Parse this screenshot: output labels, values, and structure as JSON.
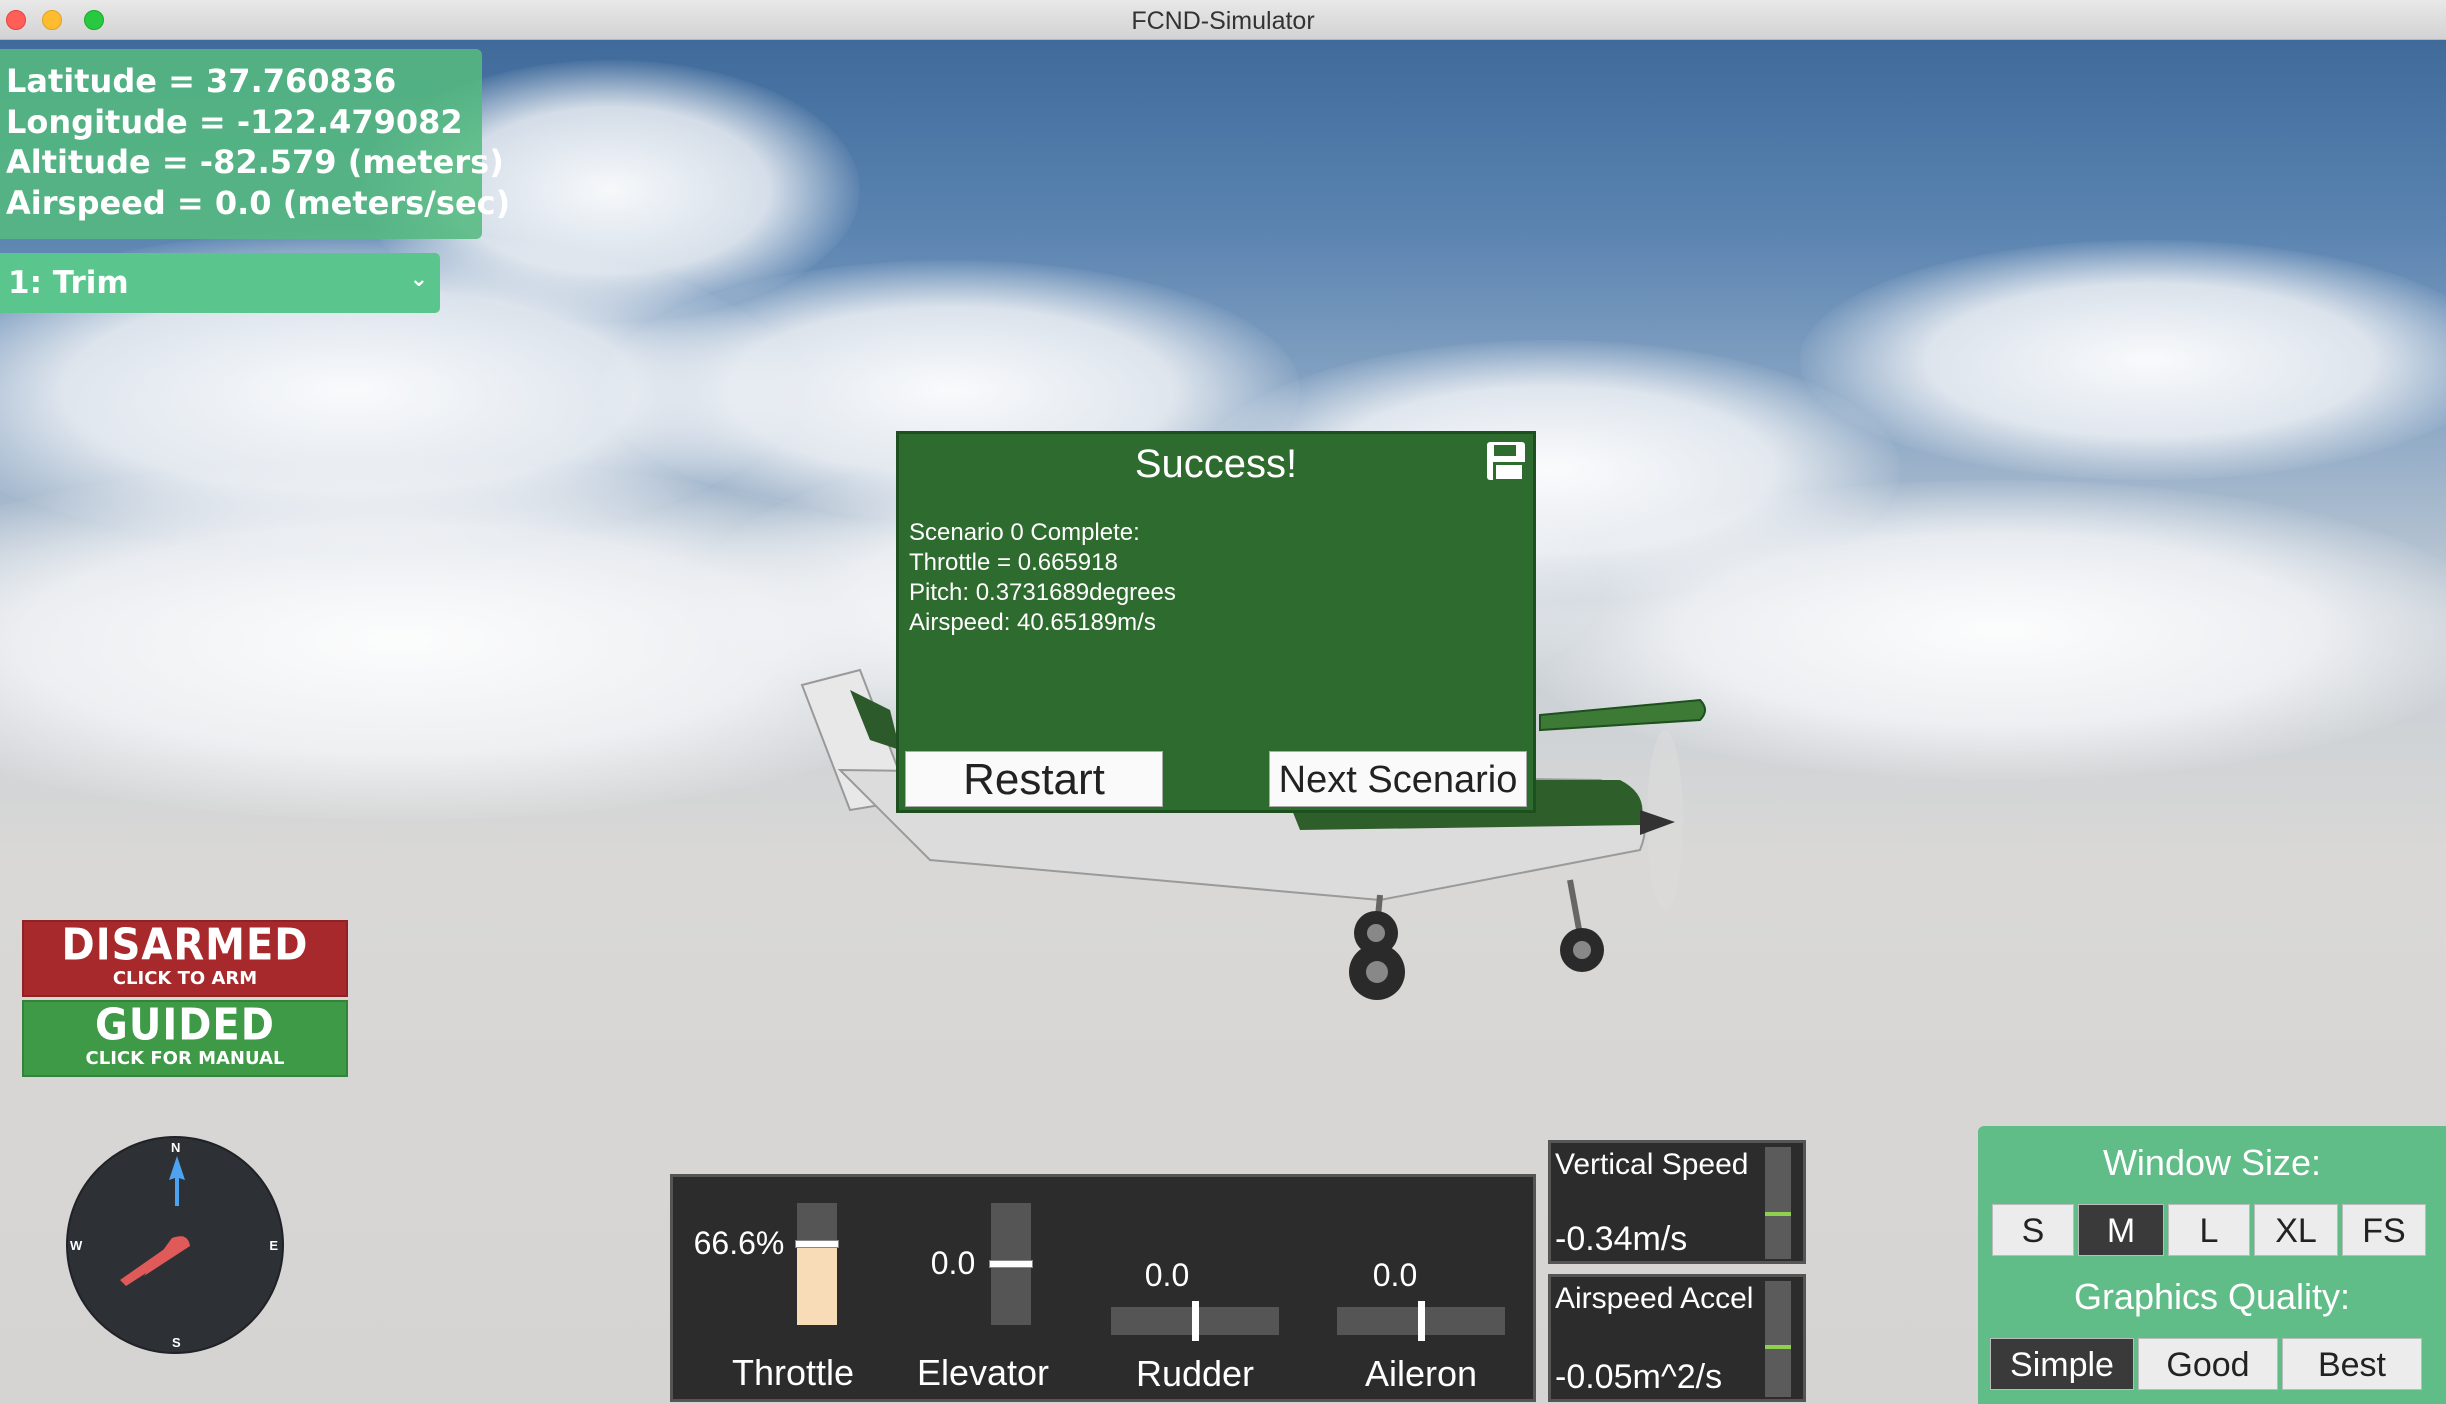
{
  "window": {
    "title": "FCND-Simulator"
  },
  "telemetry": {
    "latitude": "Latitude = 37.760836",
    "longitude": "Longitude = -122.479082",
    "altitude": "Altitude = -82.579 (meters)",
    "airspeed": "Airspeed = 0.0 (meters/sec)"
  },
  "scenario_select": {
    "value": "1: Trim"
  },
  "mode": {
    "armed_label": "DISARMED",
    "armed_sub": "CLICK TO ARM",
    "flight_label": "GUIDED",
    "flight_sub": "CLICK FOR MANUAL",
    "armed_color": "#a8292b",
    "guided_color": "#3e9a46"
  },
  "compass": {
    "n": "N",
    "e": "E",
    "s": "S",
    "w": "W",
    "heading_icon": "heading-arrow-icon"
  },
  "dialog": {
    "title": "Success!",
    "lines": [
      "Scenario 0 Complete:",
      "Throttle = 0.665918",
      "Pitch: 0.3731689degrees",
      "Airspeed: 40.65189m/s"
    ],
    "restart_label": "Restart",
    "next_label": "Next Scenario",
    "save_icon": "floppy-disk-icon"
  },
  "controls": {
    "throttle": {
      "label": "Throttle",
      "value": "66.6%",
      "level": 0.666
    },
    "elevator": {
      "label": "Elevator",
      "value": "0.0",
      "level": 0.5
    },
    "rudder": {
      "label": "Rudder",
      "value": "0.0",
      "level": 0.5
    },
    "aileron": {
      "label": "Aileron",
      "value": "0.0",
      "level": 0.5
    }
  },
  "gauges": {
    "vertical_speed": {
      "label": "Vertical Speed",
      "value": "-0.34m/s",
      "level": 0.42
    },
    "airspeed_accel": {
      "label": "Airspeed Accel",
      "value": "-0.05m^2/s",
      "level": 0.45
    }
  },
  "settings": {
    "window_size_title": "Window Size:",
    "window_sizes": [
      "S",
      "M",
      "L",
      "XL",
      "FS"
    ],
    "window_size_selected": "M",
    "graphics_title": "Graphics Quality:",
    "graphics_options": [
      "Simple",
      "Good",
      "Best"
    ],
    "graphics_selected": "Simple"
  }
}
